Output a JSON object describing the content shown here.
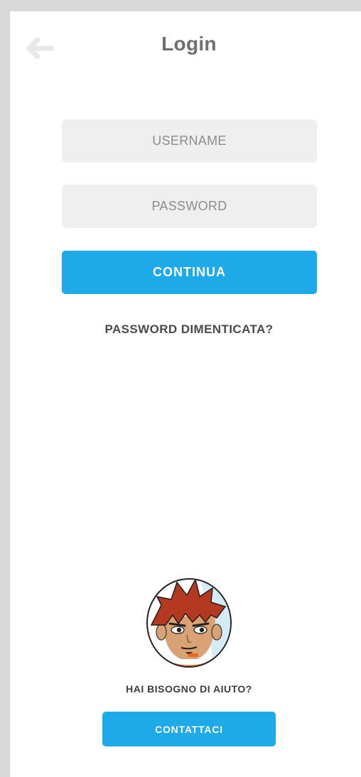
{
  "header": {
    "title": "Login",
    "back_icon": "arrow-left-icon"
  },
  "form": {
    "username_placeholder": "USERNAME",
    "username_value": "",
    "password_placeholder": "PASSWORD",
    "password_value": "",
    "submit_label": "CONTINUA",
    "forgot_label": "PASSWORD DIMENTICATA?"
  },
  "help": {
    "avatar_icon": "cartoon-avatar-icon",
    "question": "HAI BISOGNO DI AIUTO?",
    "contact_label": "CONTATTACI"
  },
  "colors": {
    "accent": "#1eaae9",
    "field_bg": "#efefef",
    "page_bg": "#d9d9d9",
    "panel_bg": "#ffffff"
  }
}
